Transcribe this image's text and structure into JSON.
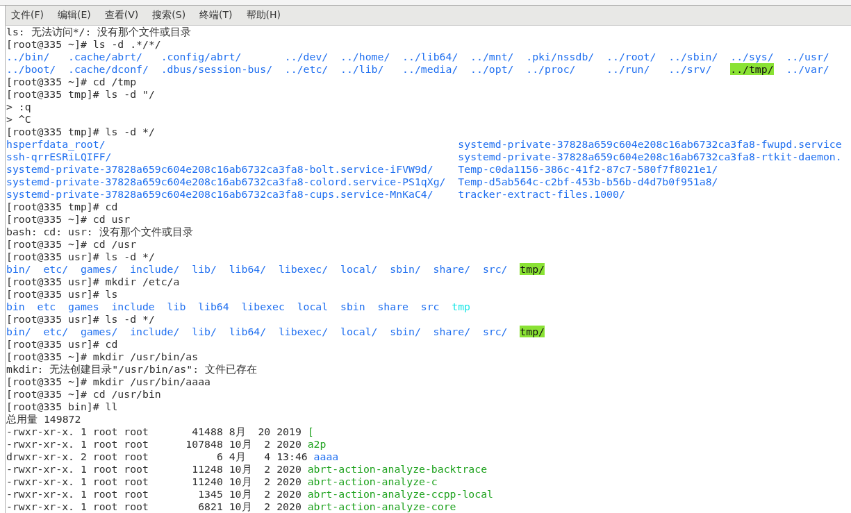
{
  "menu": [
    {
      "label": "文件(F)"
    },
    {
      "label": "编辑(E)"
    },
    {
      "label": "查看(V)"
    },
    {
      "label": "搜索(S)"
    },
    {
      "label": "终端(T)"
    },
    {
      "label": "帮助(H)"
    }
  ],
  "lines": [
    {
      "segments": [
        {
          "kind": "plain",
          "text": "ls: 无法访问*/: 没有那个文件或目录"
        }
      ]
    },
    {
      "segments": [
        {
          "kind": "plain",
          "text": "[root@335 ~]# ls -d .*/*/"
        }
      ]
    },
    {
      "kind": "grid",
      "rows": [
        [
          {
            "kind": "dir",
            "text": "../bin/"
          },
          {
            "kind": "dir",
            "text": ".cache/abrt/"
          },
          {
            "kind": "dir",
            "text": ".config/abrt/"
          },
          {
            "kind": "dir",
            "text": "../dev/"
          },
          {
            "kind": "dir",
            "text": "../home/"
          },
          {
            "kind": "dir",
            "text": "../lib64/"
          },
          {
            "kind": "dir",
            "text": "../mnt/"
          },
          {
            "kind": "dir",
            "text": ".pki/nssdb/"
          },
          {
            "kind": "dir",
            "text": "../root/"
          },
          {
            "kind": "dir",
            "text": "../sbin/"
          },
          {
            "kind": "dir",
            "text": "../sys/"
          },
          {
            "kind": "dir",
            "text": "../usr/"
          }
        ],
        [
          {
            "kind": "dir",
            "text": "../boot/"
          },
          {
            "kind": "dir",
            "text": ".cache/dconf/"
          },
          {
            "kind": "dir",
            "text": ".dbus/session-bus/"
          },
          {
            "kind": "dir",
            "text": "../etc/"
          },
          {
            "kind": "dir",
            "text": "../lib/"
          },
          {
            "kind": "dir",
            "text": "../media/"
          },
          {
            "kind": "dir",
            "text": "../opt/"
          },
          {
            "kind": "dir",
            "text": "../proc/"
          },
          {
            "kind": "dir",
            "text": "../run/"
          },
          {
            "kind": "dir",
            "text": "../srv/"
          },
          {
            "kind": "highlight",
            "text": "../tmp/"
          },
          {
            "kind": "dir",
            "text": "../var/"
          }
        ]
      ]
    },
    {
      "segments": [
        {
          "kind": "plain",
          "text": "[root@335 ~]# cd /tmp"
        }
      ]
    },
    {
      "segments": [
        {
          "kind": "plain",
          "text": "[root@335 tmp]# ls -d \"/"
        }
      ]
    },
    {
      "segments": [
        {
          "kind": "plain",
          "text": "> :q"
        }
      ]
    },
    {
      "segments": [
        {
          "kind": "plain",
          "text": "> ^C"
        }
      ]
    },
    {
      "segments": [
        {
          "kind": "plain",
          "text": "[root@335 tmp]# ls -d */"
        }
      ]
    },
    {
      "kind": "grid",
      "rows": [
        [
          {
            "kind": "dir",
            "text": "hsperfdata_root/"
          },
          {
            "kind": "dir",
            "text": "systemd-private-37828a659c604e208c16ab6732ca3fa8-fwupd.service"
          }
        ],
        [
          {
            "kind": "dir",
            "text": "ssh-qrrESRiLQIFF/"
          },
          {
            "kind": "dir",
            "text": "systemd-private-37828a659c604e208c16ab6732ca3fa8-rtkit-daemon."
          }
        ],
        [
          {
            "kind": "dir",
            "text": "systemd-private-37828a659c604e208c16ab6732ca3fa8-bolt.service-iFVW9d/"
          },
          {
            "kind": "dir",
            "text": "Temp-c0da1156-386c-41f2-87c7-580f7f8021e1/"
          }
        ],
        [
          {
            "kind": "dir",
            "text": "systemd-private-37828a659c604e208c16ab6732ca3fa8-colord.service-PS1qXg/"
          },
          {
            "kind": "dir",
            "text": "Temp-d5ab564c-c2bf-453b-b56b-d4d7b0f951a8/"
          }
        ],
        [
          {
            "kind": "dir",
            "text": "systemd-private-37828a659c604e208c16ab6732ca3fa8-cups.service-MnKaC4/"
          },
          {
            "kind": "dir",
            "text": "tracker-extract-files.1000/"
          }
        ]
      ]
    },
    {
      "segments": [
        {
          "kind": "plain",
          "text": "[root@335 tmp]# cd"
        }
      ]
    },
    {
      "segments": [
        {
          "kind": "plain",
          "text": "[root@335 ~]# cd usr"
        }
      ]
    },
    {
      "segments": [
        {
          "kind": "plain",
          "text": "bash: cd: usr: 没有那个文件或目录"
        }
      ]
    },
    {
      "segments": [
        {
          "kind": "plain",
          "text": "[root@335 ~]# cd /usr"
        }
      ]
    },
    {
      "segments": [
        {
          "kind": "plain",
          "text": "[root@335 usr]# ls -d */"
        }
      ]
    },
    {
      "kind": "grid",
      "rows": [
        [
          {
            "kind": "dir",
            "text": "bin/"
          },
          {
            "kind": "dir",
            "text": "etc/"
          },
          {
            "kind": "dir",
            "text": "games/"
          },
          {
            "kind": "dir",
            "text": "include/"
          },
          {
            "kind": "dir",
            "text": "lib/"
          },
          {
            "kind": "dir",
            "text": "lib64/"
          },
          {
            "kind": "dir",
            "text": "libexec/"
          },
          {
            "kind": "dir",
            "text": "local/"
          },
          {
            "kind": "dir",
            "text": "sbin/"
          },
          {
            "kind": "dir",
            "text": "share/"
          },
          {
            "kind": "dir",
            "text": "src/"
          },
          {
            "kind": "highlight",
            "text": "tmp/"
          }
        ]
      ]
    },
    {
      "segments": [
        {
          "kind": "plain",
          "text": "[root@335 usr]# mkdir /etc/a"
        }
      ]
    },
    {
      "segments": [
        {
          "kind": "plain",
          "text": "[root@335 usr]# ls"
        }
      ]
    },
    {
      "kind": "grid",
      "rows": [
        [
          {
            "kind": "dir",
            "text": "bin"
          },
          {
            "kind": "dir",
            "text": "etc"
          },
          {
            "kind": "dir",
            "text": "games"
          },
          {
            "kind": "dir",
            "text": "include"
          },
          {
            "kind": "dir",
            "text": "lib"
          },
          {
            "kind": "dir",
            "text": "lib64"
          },
          {
            "kind": "dir",
            "text": "libexec"
          },
          {
            "kind": "dir",
            "text": "local"
          },
          {
            "kind": "dir",
            "text": "sbin"
          },
          {
            "kind": "dir",
            "text": "share"
          },
          {
            "kind": "dir",
            "text": "src"
          },
          {
            "kind": "link",
            "text": "tmp"
          }
        ]
      ]
    },
    {
      "segments": [
        {
          "kind": "plain",
          "text": "[root@335 usr]# ls -d */"
        }
      ]
    },
    {
      "kind": "grid",
      "rows": [
        [
          {
            "kind": "dir",
            "text": "bin/"
          },
          {
            "kind": "dir",
            "text": "etc/"
          },
          {
            "kind": "dir",
            "text": "games/"
          },
          {
            "kind": "dir",
            "text": "include/"
          },
          {
            "kind": "dir",
            "text": "lib/"
          },
          {
            "kind": "dir",
            "text": "lib64/"
          },
          {
            "kind": "dir",
            "text": "libexec/"
          },
          {
            "kind": "dir",
            "text": "local/"
          },
          {
            "kind": "dir",
            "text": "sbin/"
          },
          {
            "kind": "dir",
            "text": "share/"
          },
          {
            "kind": "dir",
            "text": "src/"
          },
          {
            "kind": "highlight",
            "text": "tmp/"
          }
        ]
      ]
    },
    {
      "segments": [
        {
          "kind": "plain",
          "text": "[root@335 usr]# cd"
        }
      ]
    },
    {
      "segments": [
        {
          "kind": "plain",
          "text": "[root@335 ~]# mkdir /usr/bin/as"
        }
      ]
    },
    {
      "segments": [
        {
          "kind": "plain",
          "text": "mkdir: 无法创建目录\"/usr/bin/as\": 文件已存在"
        }
      ]
    },
    {
      "segments": [
        {
          "kind": "plain",
          "text": "[root@335 ~]# mkdir /usr/bin/aaaa"
        }
      ]
    },
    {
      "segments": [
        {
          "kind": "plain",
          "text": "[root@335 ~]# cd /usr/bin"
        }
      ]
    },
    {
      "segments": [
        {
          "kind": "plain",
          "text": "[root@335 bin]# ll"
        }
      ]
    },
    {
      "segments": [
        {
          "kind": "plain",
          "text": "总用量 149872"
        }
      ]
    },
    {
      "segments": [
        {
          "kind": "plain",
          "text": "-rwxr-xr-x. 1 root root       41488 8月  20 2019"
        },
        {
          "kind": "exec",
          "text": "["
        }
      ]
    },
    {
      "segments": [
        {
          "kind": "plain",
          "text": "-rwxr-xr-x. 1 root root      107848 10月  2 2020"
        },
        {
          "kind": "exec",
          "text": "a2p"
        }
      ]
    },
    {
      "segments": [
        {
          "kind": "plain",
          "text": "drwxr-xr-x. 2 root root           6 4月   4 13:46"
        },
        {
          "kind": "dir",
          "text": "aaaa"
        }
      ]
    },
    {
      "segments": [
        {
          "kind": "plain",
          "text": "-rwxr-xr-x. 1 root root       11248 10月  2 2020"
        },
        {
          "kind": "exec",
          "text": "abrt-action-analyze-backtrace"
        }
      ]
    },
    {
      "segments": [
        {
          "kind": "plain",
          "text": "-rwxr-xr-x. 1 root root       11240 10月  2 2020"
        },
        {
          "kind": "exec",
          "text": "abrt-action-analyze-c"
        }
      ]
    },
    {
      "segments": [
        {
          "kind": "plain",
          "text": "-rwxr-xr-x. 1 root root        1345 10月  2 2020"
        },
        {
          "kind": "exec",
          "text": "abrt-action-analyze-ccpp-local"
        }
      ]
    },
    {
      "segments": [
        {
          "kind": "plain",
          "text": "-rwxr-xr-x. 1 root root        6821 10月  2 2020"
        },
        {
          "kind": "exec",
          "text": "abrt-action-analyze-core"
        }
      ]
    }
  ]
}
